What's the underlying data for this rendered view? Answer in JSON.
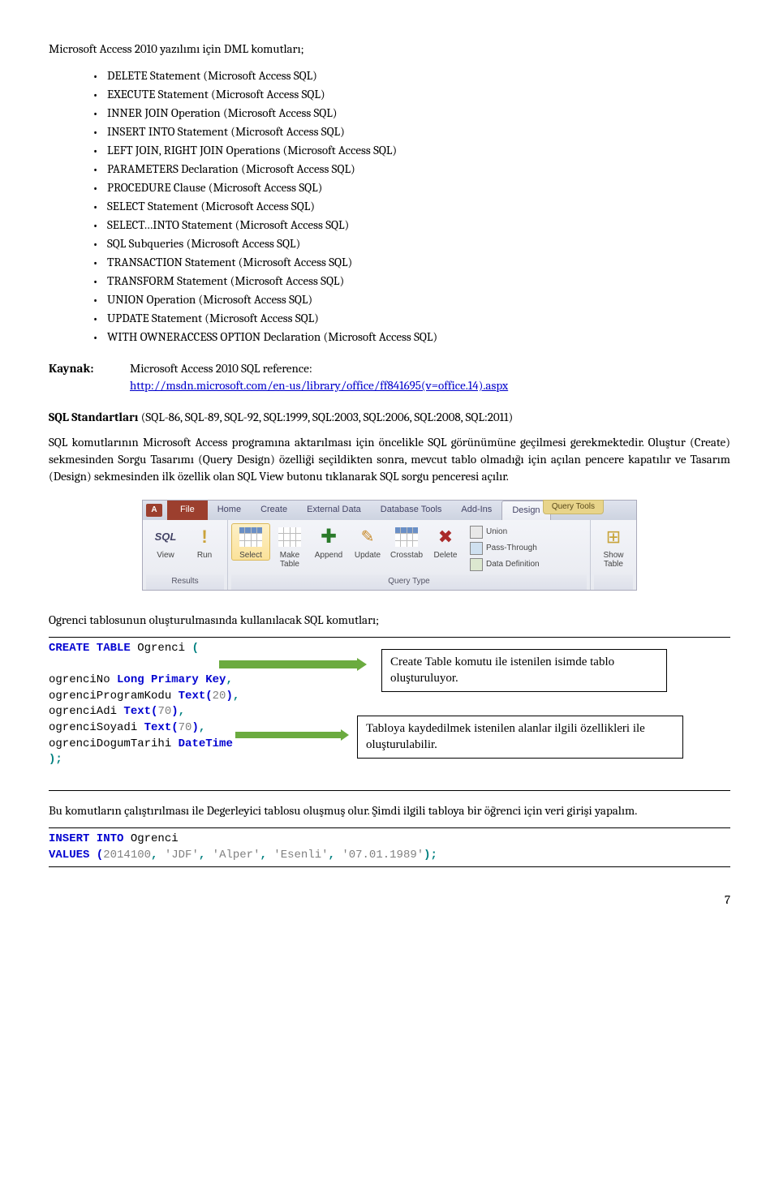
{
  "intro": "Microsoft Access 2010 yazılımı için DML komutları;",
  "bullets": [
    "DELETE Statement (Microsoft Access SQL)",
    "EXECUTE Statement (Microsoft Access SQL)",
    "INNER JOIN Operation (Microsoft Access SQL)",
    "INSERT INTO Statement (Microsoft Access SQL)",
    "LEFT JOIN, RIGHT JOIN Operations (Microsoft Access SQL)",
    "PARAMETERS Declaration (Microsoft Access SQL)",
    "PROCEDURE Clause (Microsoft Access SQL)",
    "SELECT Statement (Microsoft Access SQL)",
    "SELECT…INTO Statement (Microsoft Access SQL)",
    "SQL Subqueries (Microsoft Access SQL)",
    "TRANSACTION Statement (Microsoft Access SQL)",
    "TRANSFORM Statement (Microsoft Access SQL)",
    "UNION Operation (Microsoft Access SQL)",
    "UPDATE Statement (Microsoft Access SQL)",
    "WITH OWNERACCESS OPTION Declaration (Microsoft Access SQL)"
  ],
  "kaynak": {
    "label": "Kaynak:",
    "line1": "Microsoft Access 2010 SQL reference:",
    "url": "http://msdn.microsoft.com/en-us/library/office/ff841695(v=office.14).aspx"
  },
  "para1a": "SQL Standartları",
  "para1b": " (SQL-86, SQL-89, SQL-92, SQL:1999, SQL:2003, SQL:2006, SQL:2008, SQL:2011)",
  "para2": "SQL komutlarının Microsoft Access programına aktarılması için öncelikle SQL görünümüne geçilmesi gerekmektedir. Oluştur (Create) sekmesinden Sorgu Tasarımı (Query Design) özelliği seçildikten sonra, mevcut tablo olmadığı için açılan pencere kapatılır ve Tasarım (Design) sekmesinden ilk özellik olan SQL View butonu tıklanarak SQL sorgu penceresi açılır.",
  "ribbon": {
    "app": "A",
    "qt": "Query Tools",
    "tabs": {
      "file": "File",
      "home": "Home",
      "create": "Create",
      "ext": "External Data",
      "db": "Database Tools",
      "add": "Add-Ins",
      "design": "Design"
    },
    "btns": {
      "sql": "SQL",
      "view": "View",
      "run": "Run",
      "select": "Select",
      "mkt": "Make\nTable",
      "append": "Append",
      "update": "Update",
      "cross": "Crosstab",
      "delete": "Delete",
      "union": "Union",
      "pass": "Pass-Through",
      "datadef": "Data Definition",
      "show": "Show\nTable"
    },
    "groups": {
      "results": "Results",
      "qtype": "Query Type"
    }
  },
  "para3": "Ogrenci tablosunun oluşturulmasında kullanılacak SQL komutları;",
  "code1": {
    "l1a": "CREATE TABLE ",
    "l1b": "Ogrenci ",
    "l1c": "(",
    "l2a": "ogrenciNo ",
    "l2b": "Long Primary Key",
    "l2c": ",",
    "l3a": "ogrenciProgramKodu ",
    "l3b": "Text(",
    "l3c": "20",
    "l3d": ")",
    "l3e": ",",
    "l4a": "ogrenciAdi ",
    "l4b": "Text(",
    "l4c": "70",
    "l4d": ")",
    "l4e": ",",
    "l5a": "ogrenciSoyadi ",
    "l5b": "Text(",
    "l5c": "70",
    "l5d": ")",
    "l5e": ",",
    "l6a": "ogrenciDogumTarihi ",
    "l6b": "DateTime",
    "l7": ");"
  },
  "callout1": "Create Table komutu ile istenilen isimde tablo oluşturuluyor.",
  "callout2": "Tabloya kaydedilmek istenilen alanlar ilgili özellikleri ile oluşturulabilir.",
  "para4": "Bu komutların çalıştırılması ile Degerleyici tablosu oluşmuş olur.  Şimdi ilgili tabloya bir öğrenci için veri girişi yapalım.",
  "code2": {
    "l1a": "INSERT INTO ",
    "l1b": "Ogrenci",
    "l2a": "VALUES (",
    "l2b": "2014100",
    "l2c": ", ",
    "l2d": "'JDF'",
    "l2e": ", ",
    "l2f": "'Alper'",
    "l2g": ", ",
    "l2h": "'Esenli'",
    "l2i": ", ",
    "l2j": "'07.01.1989'",
    "l2k": ");"
  },
  "page": "7"
}
